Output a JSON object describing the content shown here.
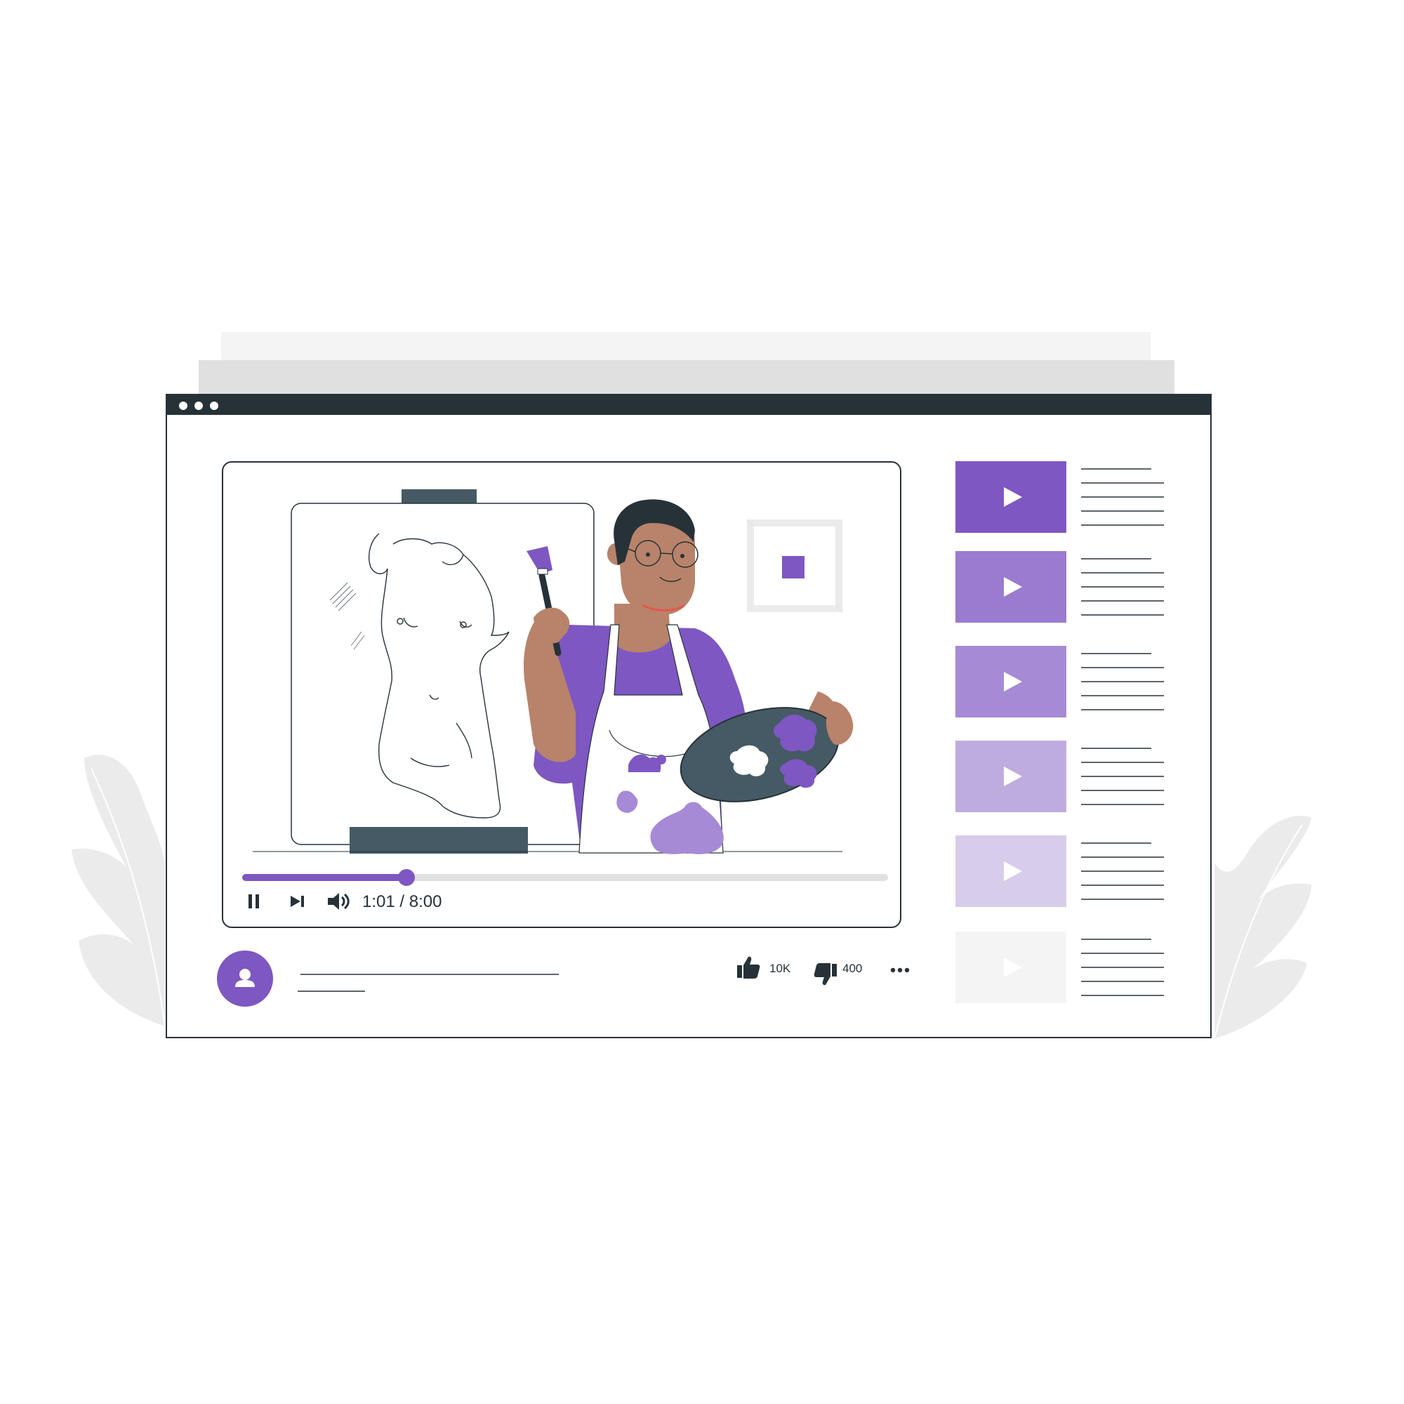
{
  "window": {
    "title_dots": 3
  },
  "player": {
    "current_time": "1:01",
    "duration": "8:00",
    "time_separator": " / ",
    "progress_fraction": 0.2542,
    "state": "playing",
    "controls": {
      "pause_icon": "pause-icon",
      "next_icon": "skip-next-icon",
      "volume_icon": "volume-icon"
    }
  },
  "video_info": {
    "channel_icon": "user-icon",
    "likes_count": "10K",
    "dislikes_count": "400",
    "likes_icon": "thumbs-up-icon",
    "dislikes_icon": "thumbs-down-icon",
    "more_icon": "more-horizontal-icon"
  },
  "playlist": {
    "items": [
      {
        "color": "#7e57c2",
        "icon": "play-icon"
      },
      {
        "color": "#9a7bcf",
        "icon": "play-icon"
      },
      {
        "color": "#a68ad5",
        "icon": "play-icon"
      },
      {
        "color": "#bfacdf",
        "icon": "play-icon"
      },
      {
        "color": "#d8cceb",
        "icon": "play-icon"
      },
      {
        "color": "#f4f4f4",
        "icon": "play-icon"
      }
    ]
  },
  "colors": {
    "accent": "#7e57c2",
    "dark": "#263238",
    "slate": "#455a64",
    "skin": "#b8836a",
    "leaf": "#ebebeb"
  }
}
